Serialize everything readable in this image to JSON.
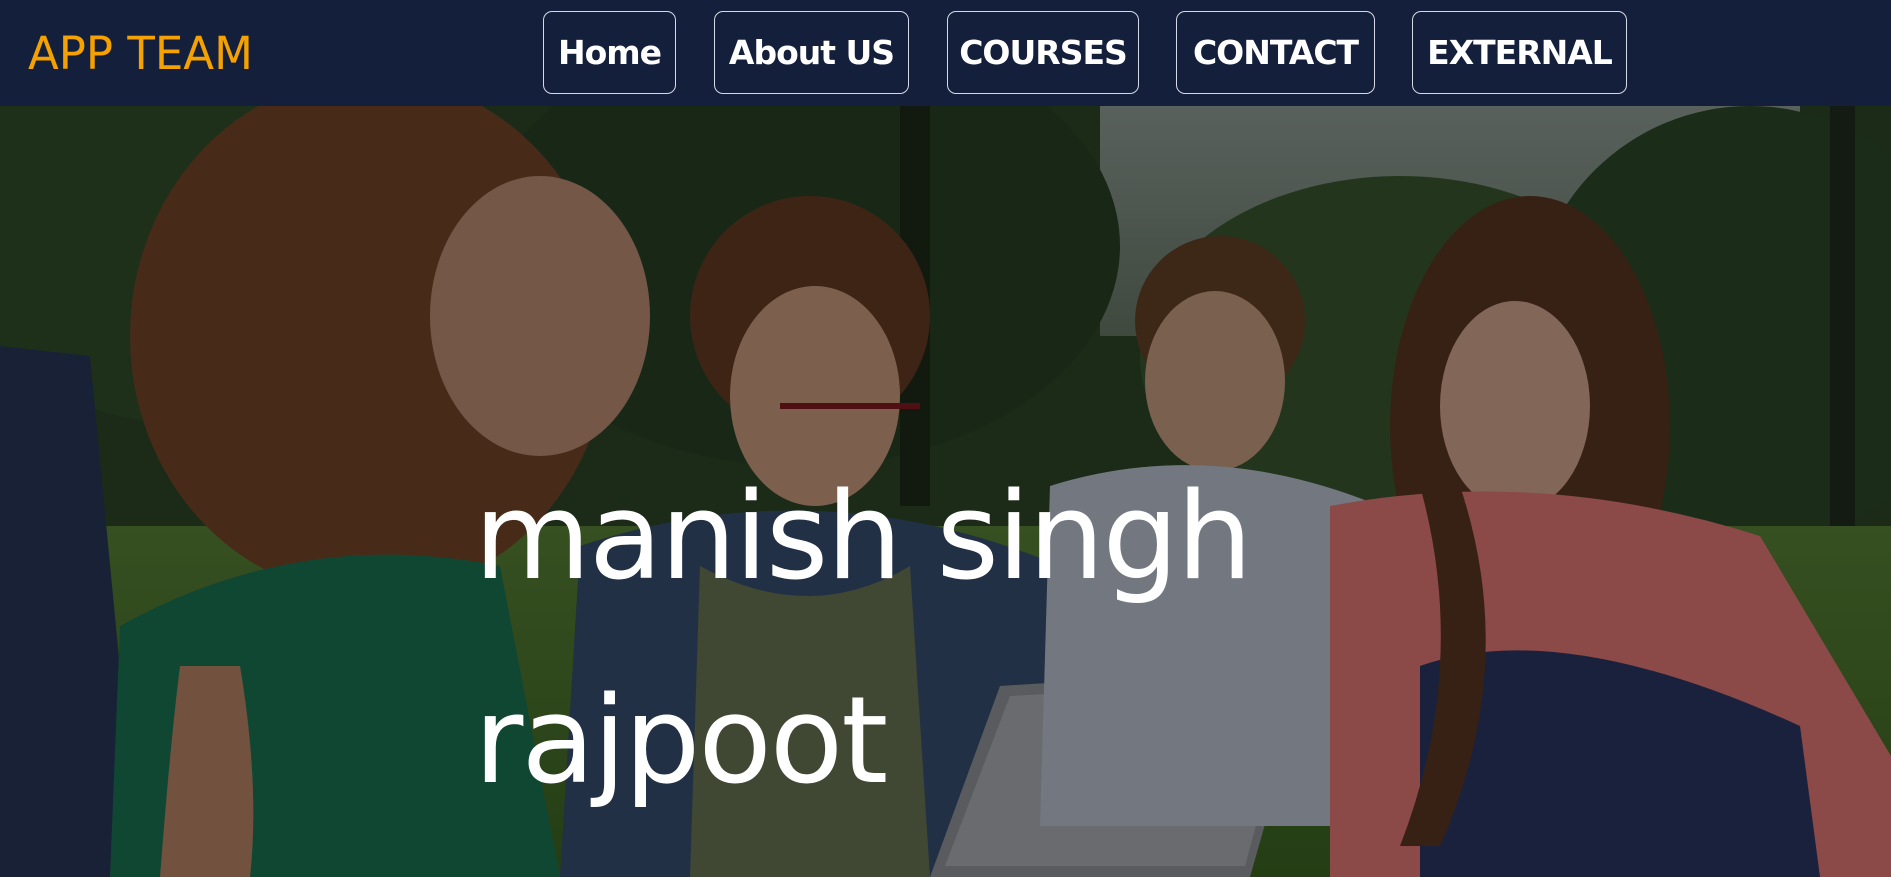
{
  "brand": "APP TEAM",
  "nav": {
    "items": [
      {
        "label": "Home"
      },
      {
        "label": "About US"
      },
      {
        "label": "COURSES"
      },
      {
        "label": "CONTACT"
      },
      {
        "label": "EXTERNAL"
      }
    ]
  },
  "hero": {
    "title": "manish singh rajpoot",
    "image_description_icon": "students-photo"
  },
  "colors": {
    "navbar_bg": "#141f3b",
    "brand": "#f5a100",
    "nav_text": "#ffffff",
    "nav_border": "#d6dae6",
    "hero_text": "#ffffff"
  }
}
